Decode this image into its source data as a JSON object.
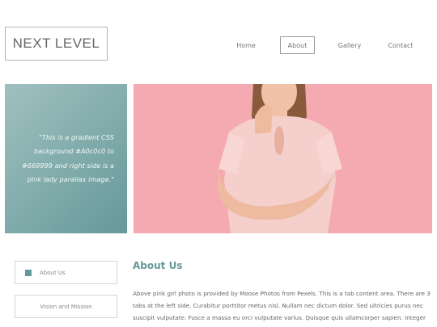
{
  "header": {
    "logo_text": "NEXT LEVEL",
    "nav": [
      {
        "label": "Home",
        "active": false
      },
      {
        "label": "About",
        "active": true
      },
      {
        "label": "Gallery",
        "active": false
      },
      {
        "label": "Contact",
        "active": false
      }
    ]
  },
  "hero": {
    "quote": "\"This is a gradient CSS background #A0c0c0 to #669999 and right side is a pink lady parallax image.\"",
    "gradient_from": "#A0c0c0",
    "gradient_to": "#669999",
    "photo_background": "#f4aab0"
  },
  "tabs": [
    {
      "label": "About Us",
      "active": true
    },
    {
      "label": "Vision and Mission",
      "active": false
    }
  ],
  "content": {
    "title": "About Us",
    "text": "Above pink girl photo is provided by Moose Photos from Pexels. This is a tab content area. There are 3 tabs at the left side. Curabitur porttitor metus nisl. Nullam nec dictum dolor. Sed ultricies purus nec suscipit vulputate. Fusce a massa eu orci vulputate varius. Quisque quis ullamcorper sapien. Integer eu"
  },
  "colors": {
    "accent": "#669999",
    "border": "#d4d4d4"
  }
}
